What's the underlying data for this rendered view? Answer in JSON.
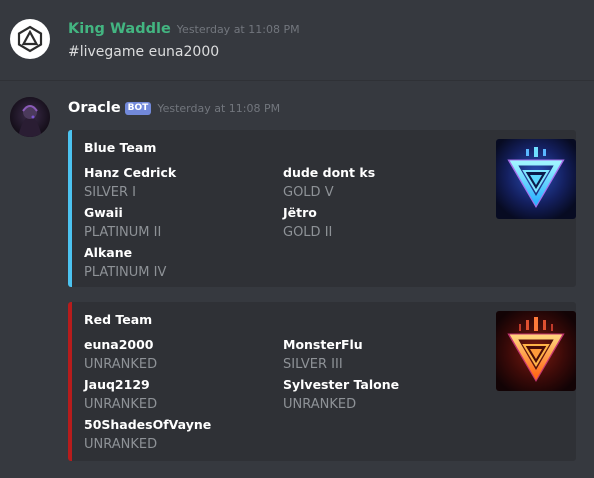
{
  "messages": [
    {
      "author": "King Waddle",
      "timestamp": "Yesterday at 11:08 PM",
      "content": "#livegame euna2000",
      "avatar_icon": "octahedron-logo-icon"
    },
    {
      "author": "Oracle",
      "bot_tag": "BOT",
      "timestamp": "Yesterday at 11:08 PM",
      "avatar_icon": "dark-character-avatar",
      "embeds": [
        {
          "title": "Blue Team",
          "accent_color": "#4cc3f0",
          "thumbnail_icon": "blue-triangle-emblem-icon",
          "column1": [
            {
              "name": "Hanz Cedrick",
              "rank": "SILVER I"
            },
            {
              "name": "Gwaii",
              "rank": "PLATINUM II"
            },
            {
              "name": "Alkane",
              "rank": "PLATINUM IV"
            }
          ],
          "column2": [
            {
              "name": "dude dont ks",
              "rank": "GOLD V"
            },
            {
              "name": "Jëtro",
              "rank": "GOLD II"
            }
          ]
        },
        {
          "title": "Red Team",
          "accent_color": "#b71c1c",
          "thumbnail_icon": "red-triangle-emblem-icon",
          "column1": [
            {
              "name": "euna2000",
              "rank": "UNRANKED"
            },
            {
              "name": "Jauq2129",
              "rank": "UNRANKED"
            },
            {
              "name": "50ShadesOfVayne",
              "rank": "UNRANKED"
            }
          ],
          "column2": [
            {
              "name": "MonsterFlu",
              "rank": "SILVER III"
            },
            {
              "name": "Sylvester Talone",
              "rank": "UNRANKED"
            }
          ]
        }
      ]
    }
  ]
}
